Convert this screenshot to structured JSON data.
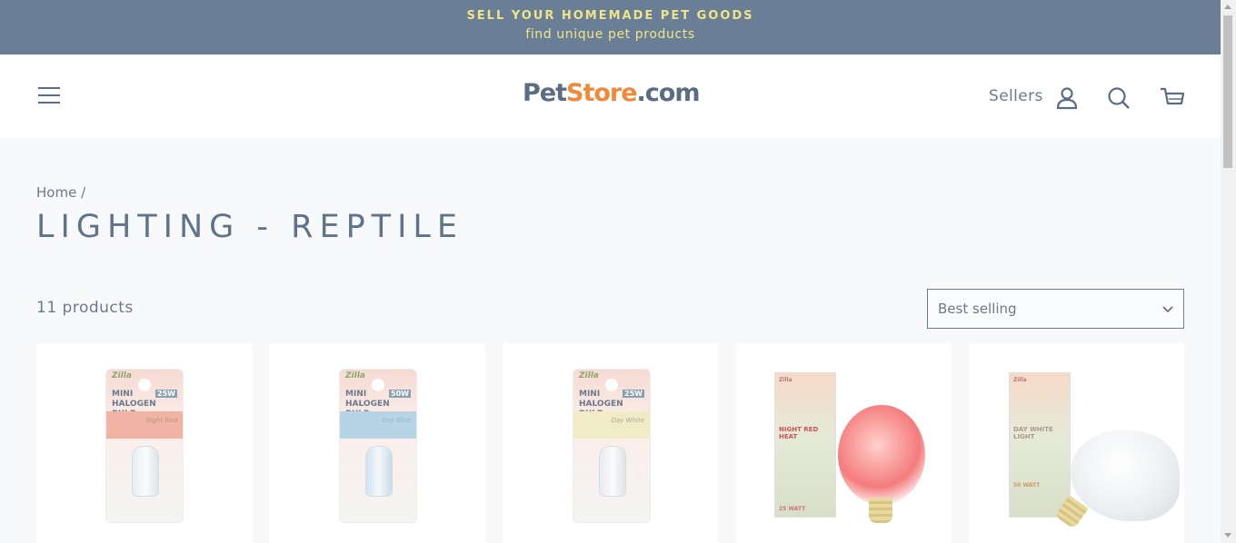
{
  "announcement": {
    "line1": "SELL YOUR HOMEMADE PET GOODS",
    "line2": "find unique pet products"
  },
  "header": {
    "logo_part1": "Pet",
    "logo_part2": "Store",
    "logo_part3": ".com",
    "sellers_label": "Sellers",
    "icons": [
      "menu-icon",
      "user-icon",
      "search-icon",
      "cart-icon"
    ]
  },
  "breadcrumb": {
    "home": "Home",
    "separator": "/"
  },
  "page": {
    "title": "LIGHTING - REPTILE",
    "count": "11 products"
  },
  "sort": {
    "selected": "Best selling"
  },
  "products": [
    {
      "brand": "Zilla",
      "title_line1": "MINI",
      "title_line2": "HALOGEN BULB",
      "watt": "25W",
      "variant": "Night Red",
      "accent": "#e27a63"
    },
    {
      "brand": "Zilla",
      "title_line1": "MINI",
      "title_line2": "HALOGEN BULB",
      "watt": "50W",
      "variant": "Day Blue",
      "accent": "#8fc0e0"
    },
    {
      "brand": "Zilla",
      "title_line1": "MINI",
      "title_line2": "HALOGEN BULB",
      "watt": "25W",
      "variant": "Day White",
      "accent": "#efe6b4"
    },
    {
      "brand": "Zilla",
      "title_line1": "NIGHT RED",
      "title_line2": "HEAT",
      "watt": "25 WATT",
      "accent": "#f25d5d"
    },
    {
      "brand": "Zilla",
      "title_line1": "DAY WHITE",
      "title_line2": "LIGHT",
      "watt": "50 WATT",
      "accent": "#f3dc7a"
    }
  ],
  "colors": {
    "announcement_bg": "#6a7f96",
    "announcement_text": "#eee58a",
    "logo_orange": "#f08a3a",
    "logo_slate": "#5b6d82"
  }
}
